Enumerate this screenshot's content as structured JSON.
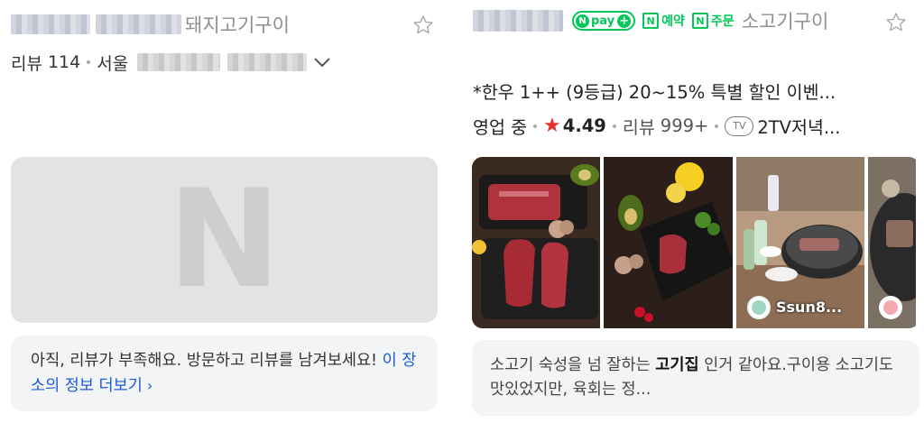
{
  "left_card": {
    "category": "돼지고기구이",
    "review_label": "리뷰",
    "review_count": "114",
    "location": "서울",
    "placeholder_letter": "N",
    "empty_review_text": "아직, 리뷰가 부족해요. 방문하고 리뷰를 남겨보세요!",
    "more_info_link": "이 장소의 정보 더보기"
  },
  "right_card": {
    "npay_label": "pay",
    "reserve_label": "예약",
    "order_label": "주문",
    "category": "소고기구이",
    "promo": "*한우 1++ (9등급) 20~15% 특별 할인 이벤...",
    "status": "영업 중",
    "rating": "4.49",
    "review_label": "리뷰",
    "review_count": "999+",
    "tv_label": "TV",
    "tv_program": "2TV저녁...",
    "photo_user": "Ssun8...",
    "review_pre": "소고기 숙성을 넘 잘하는 ",
    "review_bold": "고기집",
    "review_post": " 인거 같아요.구이용 소고기도 맛있었지만, 육회는 정..."
  },
  "colors": {
    "naver_green": "#03c75a",
    "link_blue": "#1c5bd6",
    "star_red": "#e5322d"
  }
}
